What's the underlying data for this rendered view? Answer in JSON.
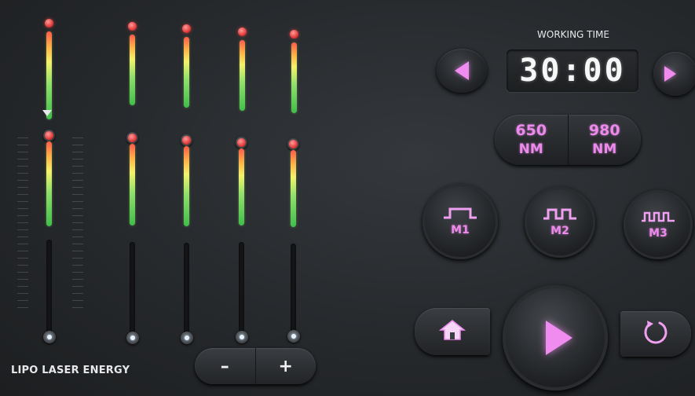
{
  "energy_label": "LIPO LASER ENERGY",
  "working_time": {
    "label": "WORKING TIME",
    "value": "30:00"
  },
  "wavelengths": [
    {
      "value": "650",
      "unit": "NM"
    },
    {
      "value": "980",
      "unit": "NM"
    }
  ],
  "modes": [
    {
      "label": "M1",
      "icon": "single-pulse-wave-icon"
    },
    {
      "label": "M2",
      "icon": "double-pulse-wave-icon"
    },
    {
      "label": "M3",
      "icon": "triple-pulse-wave-icon"
    }
  ],
  "adjust": {
    "minus_label": "–",
    "plus_label": "+"
  },
  "icons": {
    "prev": "triangle-left-icon",
    "next": "triangle-right-icon",
    "home": "home-icon",
    "play": "play-icon",
    "refresh": "refresh-icon"
  },
  "colors": {
    "accent": "#ec8aec",
    "level_top": "#ff5a4a",
    "level_bottom": "#3fbf4a",
    "background": "#26292c"
  }
}
